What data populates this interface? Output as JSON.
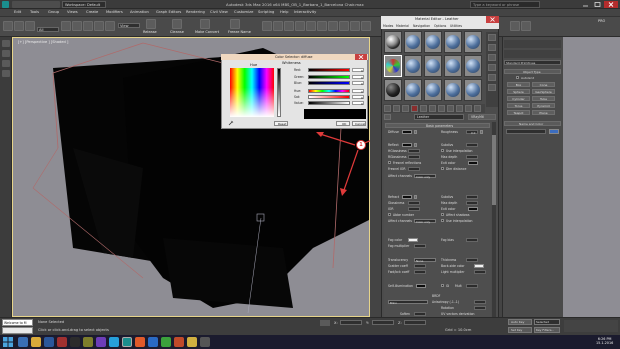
{
  "window": {
    "title": "Autodesk 3ds Max 2016 x64      MBS_OB_1_Barbara_1_Barcelona Chair.max",
    "workspace": "Workspace: Default",
    "search_placeholder": "Type a keyword or phrase",
    "sign_in": "Sign In"
  },
  "menu": [
    "Edit",
    "Tools",
    "Group",
    "Views",
    "Create",
    "Modifiers",
    "Animation",
    "Graph Editors",
    "Rendering",
    "Civil View",
    "Customize",
    "Scripting",
    "Help",
    "Interactivity"
  ],
  "ribbon": {
    "view_dropdown": "View",
    "filter": "All",
    "create_selection_label": "Create Selection Se",
    "release_label": "Release",
    "cleanse_label": "Cleanse",
    "make_convert_label": "Make Convert",
    "freeze_label": "Freeze Name",
    "pro_label": "PRO",
    "lock": "[+] [Default]"
  },
  "viewport": {
    "label": "[+] [Perspective ] [Shaded ]"
  },
  "color_dialog": {
    "title": "Color Selector: diffuse",
    "hue_label": "Hue",
    "whiteness_label": "Whiteness",
    "channels": [
      {
        "name": "Red:",
        "value": "0"
      },
      {
        "name": "Green:",
        "value": "0"
      },
      {
        "name": "Blue:",
        "value": "0"
      },
      {
        "name": "Hue:",
        "value": "0"
      },
      {
        "name": "Sat:",
        "value": "0"
      },
      {
        "name": "Value:",
        "value": "0"
      }
    ],
    "reset": "Reset",
    "ok": "OK",
    "cancel": "Cancel",
    "preview_color": "#000000"
  },
  "material_editor": {
    "title": "Material Editor - Leather",
    "menus": [
      "Modes",
      "Material",
      "Navigation",
      "Options",
      "Utilities"
    ],
    "name": "Leather",
    "type": "VRayMtl",
    "rollout_title": "Basic parameters",
    "params": {
      "diffuse": "Diffuse",
      "roughness": "Roughness",
      "roughness_val": "0.0",
      "reflect": "Reflect",
      "hilight_gloss": "HGlossiness",
      "refl_gloss": "RGlossiness",
      "fresnel": "Fresnel reflections",
      "fresnel_ior": "Fresnel IOR",
      "max_depth": "Max depth",
      "exit_color": "Exit color",
      "subdivs": "Subdivs",
      "affect_channels": "Affect channels",
      "color_only": "Color only",
      "use_interp": "Use interpolation",
      "dim_distance": "Dim distance",
      "refract": "Refract",
      "ior": "IOR",
      "glossiness": "Glossiness",
      "abbe": "Abbe number",
      "affect_shadows": "Affect shadows",
      "fog_color": "Fog color",
      "fog_bias": "Fog bias",
      "fog_multiplier": "Fog multiplier",
      "translucency": "Translucency",
      "translucency_val": "None",
      "scatter_coeff": "Scatter coeff",
      "fwd_bck_coeff": "Fwd/bck coeff",
      "thickness": "Thickness",
      "back_side_color": "Back-side color",
      "light_multiplier": "Light multiplier",
      "self_illum": "Self-illumination",
      "gi": "GI",
      "mult": "Mult",
      "brdf": "BRDF",
      "brdf_type": "Blinn",
      "anisotropy": "Anisotropy (-1..1)",
      "rotation": "Rotation",
      "softer": "Soften",
      "uv_vectors": "UV vectors derivation",
      "fix_dark": "Fix dark glossy edges",
      "local_axis": "Local axis",
      "map_channel": "Map channel",
      "options": "Options"
    }
  },
  "command_panel": {
    "category": "Standard Primitives",
    "object_type": "Object Type",
    "autogrid": "AutoGrid",
    "objects": [
      "Box",
      "Cone",
      "Sphere",
      "GeoSphere",
      "Cylinder",
      "Tube",
      "Torus",
      "Pyramid",
      "Teapot",
      "Plane"
    ],
    "name_and_color": "Name and Color"
  },
  "status": {
    "welcome": "Welcome to M",
    "selected": "None Selected",
    "prompt": "Click or click-and-drag to select objects",
    "x_label": "X:",
    "y_label": "Y:",
    "z_label": "Z:",
    "grid": "Grid = 10.0cm",
    "auto_key": "Auto Key",
    "set_key": "Set Key",
    "selected_dd": "Selected",
    "key_filters": "Key Filters...",
    "add_time_tag": "Add Time Tag"
  },
  "taskbar": {
    "time": "6:26 PM",
    "date": "15.1.2016"
  },
  "annotation": "1"
}
